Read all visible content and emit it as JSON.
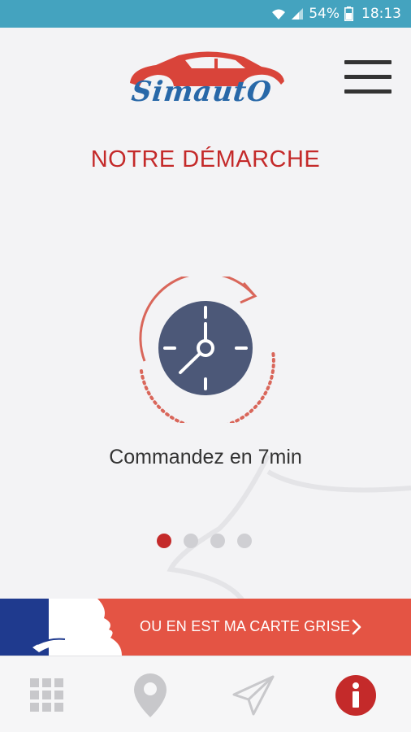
{
  "status_bar": {
    "battery_percent": "54%",
    "time": "18:13",
    "icons": [
      "wifi-icon",
      "signal-icon",
      "battery-icon"
    ]
  },
  "header": {
    "logo_text": "SimautO",
    "menu_icon": "hamburger-menu-icon"
  },
  "page": {
    "title": "NOTRE DÉMARCHE"
  },
  "carousel": {
    "current_slide": {
      "icon": "clock-icon",
      "caption": "Commandez en 7min"
    },
    "total_slides": 4,
    "active_index": 0
  },
  "banner": {
    "label": "OU EN EST MA CARTE GRISE",
    "icon": "chevron-right-icon"
  },
  "bottom_nav": {
    "items": [
      "grid-icon",
      "location-pin-icon",
      "send-icon",
      "info-icon"
    ],
    "active_index": 3
  },
  "colors": {
    "status_bar": "#44a3bf",
    "accent_red": "#c42a2a",
    "banner_red": "#e45444",
    "flag_blue": "#1f3a8e",
    "clock_face": "#4c5878",
    "logo_blue": "#2868a8"
  }
}
